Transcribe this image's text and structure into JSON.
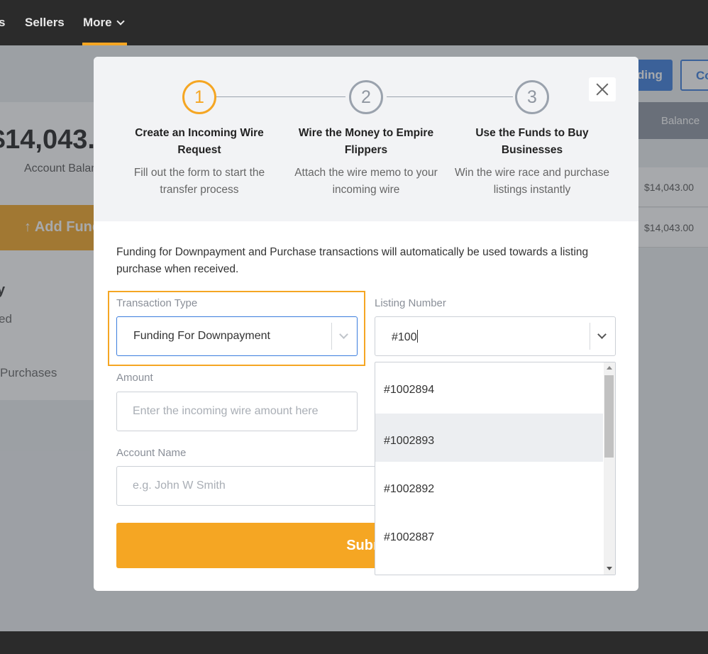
{
  "nav": {
    "items": [
      "s",
      "Sellers",
      "More"
    ]
  },
  "background": {
    "amount": "$14,043.",
    "amount_label": "Account Balan",
    "add_funds": "↑ Add Fund",
    "side_texts": [
      "y",
      "ed",
      "Purchases"
    ],
    "blue_btn": "ding",
    "outline_btn": "Co",
    "table_head": "Balance",
    "table_rows": [
      "$14,043.00",
      "$14,043.00"
    ]
  },
  "steps": [
    {
      "number": "1",
      "title": "Create an Incoming Wire Request",
      "desc": "Fill out the form to start the transfer process"
    },
    {
      "number": "2",
      "title": "Wire the Money to Empire Flippers",
      "desc": "Attach the wire memo to your incoming wire"
    },
    {
      "number": "3",
      "title": "Use the Funds to Buy Businesses",
      "desc": "Win the wire race and purchase listings instantly"
    }
  ],
  "intro": "Funding for Downpayment and Purchase transactions will automatically be used towards a listing purchase when received.",
  "form": {
    "transaction_type_label": "Transaction Type",
    "transaction_type_value": "Funding For Downpayment",
    "listing_number_label": "Listing Number",
    "listing_number_value": "#100",
    "amount_label": "Amount",
    "amount_placeholder": "Enter the incoming wire amount here",
    "account_name_label": "Account Name",
    "account_name_placeholder": "e.g. John W Smith",
    "submit_label": "Subm"
  },
  "dropdown_options": [
    "#1002894",
    "#1002893",
    "#1002892",
    "#1002887"
  ],
  "colors": {
    "accent": "#f5a623",
    "primary_blue": "#3b7ddd",
    "header_bg": "#f2f3f5"
  }
}
